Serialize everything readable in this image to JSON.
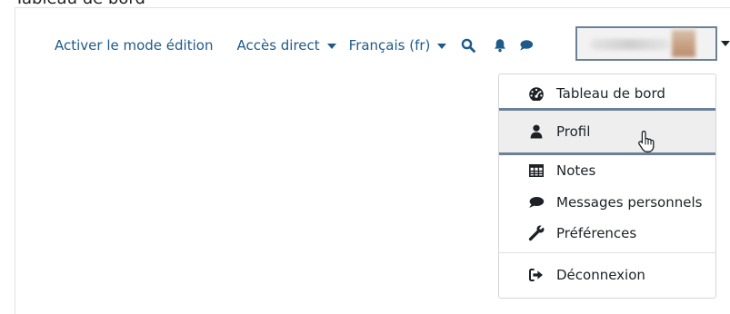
{
  "page": {
    "cutoff_title": "Tableau de bord"
  },
  "navbar": {
    "edit_mode": "Activer le mode édition",
    "direct_access": "Accès direct",
    "language": "Français ‎(fr)‎",
    "icons": [
      "search-icon",
      "bell-icon",
      "chat-icon"
    ]
  },
  "user_menu": {
    "toggle_state": "open",
    "items": [
      {
        "label": "Tableau de bord",
        "icon": "dashboard-icon"
      },
      {
        "label": "Profil",
        "icon": "user-icon",
        "hovered": true
      },
      {
        "label": "Notes",
        "icon": "table-icon"
      },
      {
        "label": "Messages personnels",
        "icon": "chat-icon"
      },
      {
        "label": "Préférences",
        "icon": "wrench-icon"
      },
      {
        "label": "Déconnexion",
        "icon": "logout-icon"
      }
    ]
  },
  "colors": {
    "link": "#1f5a8a",
    "text": "#1d2125",
    "focus_border": "#6b8196",
    "hover_bg": "#eeeeee"
  }
}
